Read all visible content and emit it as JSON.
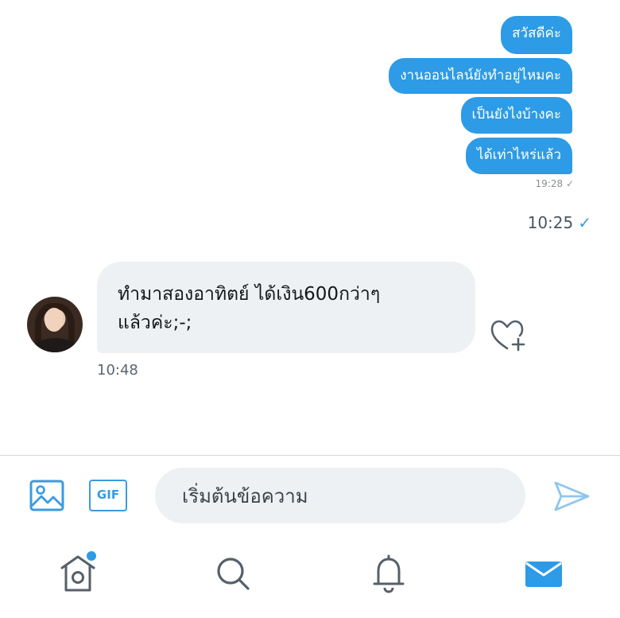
{
  "conversation": {
    "sent_messages": [
      "สวัสดีค่ะ",
      "งานออนไลน์ยังทำอยู่ไหมคะ",
      "เป็นยังไงบ้างคะ",
      "ได้เท่าไหร่แล้ว"
    ],
    "sent_meta_time": "19:28 ✓",
    "reply_time": "10:25",
    "reply_check": "✓",
    "received_message_line1": "ทำมาสองอาทิตย์ ได้เงิน600กว่าๆ",
    "received_message_line2": "แล้วค่ะ;-;",
    "received_time": "10:48"
  },
  "composer": {
    "gif_label": "GIF",
    "placeholder": "เริ่มต้นข้อความ"
  },
  "nav": {
    "items": [
      "home-icon",
      "search-icon",
      "notifications-icon",
      "messages-icon"
    ],
    "accent": "#2d9be5"
  },
  "colors": {
    "sent_bubble": "#2d9be5",
    "received_bubble": "#eef1f4",
    "accent": "#3a9be0"
  }
}
